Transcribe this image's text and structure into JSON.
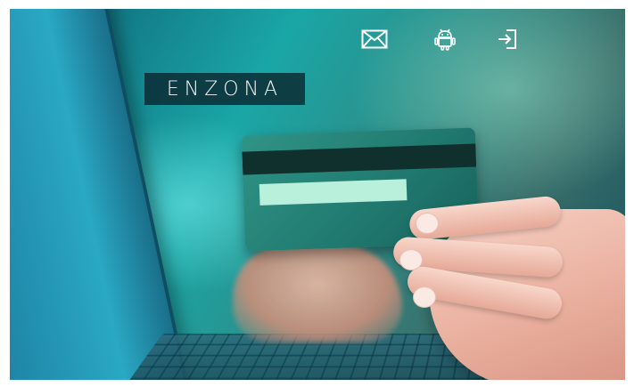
{
  "header": {
    "icons": [
      {
        "name": "mail-icon",
        "label": ""
      },
      {
        "name": "android-icon",
        "label": ""
      },
      {
        "name": "login-icon",
        "label": ""
      }
    ]
  },
  "logo": {
    "text": "ENZONA"
  },
  "colors": {
    "background": "#1aa6a6",
    "logo_bg": "#0c2c34",
    "card": "#2f9486",
    "card_stripe": "#10302e",
    "card_signature": "#b8f0dc"
  }
}
